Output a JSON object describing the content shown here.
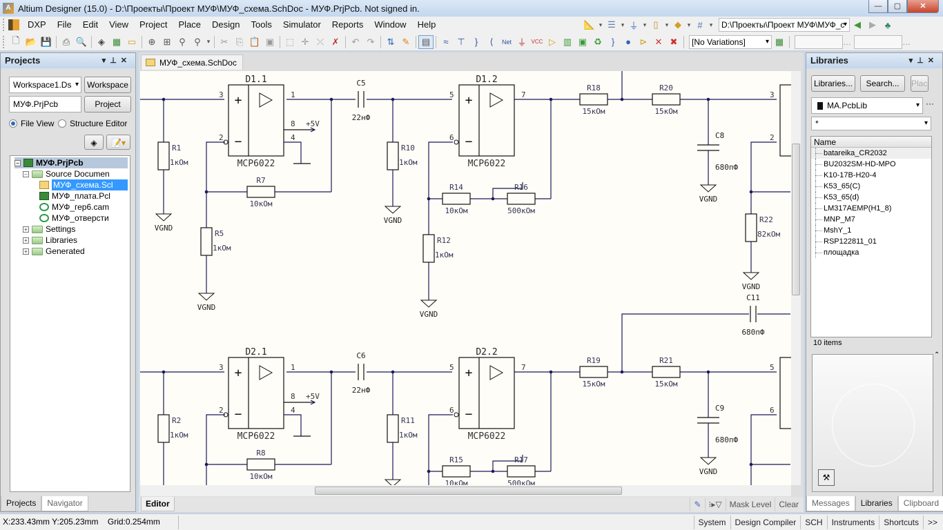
{
  "window": {
    "title": "Altium Designer (15.0) - D:\\Проекты\\Проект МУФ\\МУФ_схема.SchDoc - МУФ.PrjPcb. Not signed in.",
    "app_icon": "altium-logo-icon",
    "controls": {
      "minimize": "—",
      "maximize": "▢",
      "close": "✕"
    }
  },
  "menubar": {
    "items": [
      "DXP",
      "File",
      "Edit",
      "View",
      "Project",
      "Place",
      "Design",
      "Tools",
      "Simulator",
      "Reports",
      "Window",
      "Help"
    ],
    "path_combo": "D:\\Проекты\\Проект МУФ\\МУФ_с",
    "right_tools": [
      "measure-icon",
      "align-icon",
      "power-port-icon",
      "part-icon",
      "port-icon",
      "grid-icon"
    ]
  },
  "toolbar": {
    "buttons": [
      "new-icon",
      "open-icon",
      "save-icon",
      "print-icon",
      "print-preview-icon",
      "compile-icon",
      "pcb-icon",
      "sch-icon",
      "zoom-fit-icon",
      "zoom-area-icon",
      "zoom-selected-icon",
      "zoom-filter-icon",
      "cut-icon",
      "copy-icon",
      "paste-icon",
      "rubber-stamp-icon",
      "select-icon",
      "move-icon",
      "deselect-icon",
      "clear-filter-icon",
      "undo-icon",
      "redo-icon",
      "cross-probe-icon",
      "wand-icon",
      "browse-icon",
      "wire-icon",
      "bus-icon",
      "bus-entry-icon",
      "harness-icon",
      "net-label-icon",
      "ground-icon",
      "vcc-icon",
      "port-icon",
      "sheet-symbol-icon",
      "sheet-entry-icon",
      "device-sheet-icon",
      "harness-connector-icon",
      "harness-entry-icon",
      "parameter-icon",
      "no-erc-icon",
      "compile-mask-icon"
    ],
    "variations": "[No Variations]"
  },
  "projects_panel": {
    "title": "Projects",
    "workspace_combo": "Workspace1.Ds",
    "workspace_button": "Workspace",
    "project_field": "МУФ.PrjPcb",
    "project_button": "Project",
    "radio_file_view": "File View",
    "radio_structure": "Structure Editor",
    "selected_view": "File View",
    "tree": {
      "root": "МУФ.PrjPcb",
      "source_folder": "Source Documen",
      "docs": [
        {
          "name": "МУФ_схема.Scl",
          "type": "sch",
          "selected": true
        },
        {
          "name": "МУФ_плата.Pcl",
          "type": "pcb"
        },
        {
          "name": "МУФ_гер6.cam",
          "type": "cam"
        },
        {
          "name": "МУФ_отверсти",
          "type": "cam"
        }
      ],
      "folders": [
        "Settings",
        "Libraries",
        "Generated"
      ]
    },
    "tabs": [
      "Projects",
      "Navigator"
    ]
  },
  "editor": {
    "doc_tab": "МУФ_схема.SchDoc",
    "bottom_tab": "Editor",
    "mask_level": "Mask Level",
    "clear": "Clear"
  },
  "schematic": {
    "opamps": [
      {
        "ref": "D1.1",
        "part": "MCP6022",
        "pins": [
          "3",
          "2",
          "1",
          "8",
          "4"
        ],
        "supply": "+5V"
      },
      {
        "ref": "D1.2",
        "part": "MCP6022",
        "pins": [
          "5",
          "6",
          "7"
        ]
      },
      {
        "ref": "D2.1",
        "part": "MCP6022",
        "pins": [
          "3",
          "2",
          "1",
          "8",
          "4"
        ],
        "supply": "+5V"
      },
      {
        "ref": "D2.2",
        "part": "MCP6022",
        "pins": [
          "5",
          "6",
          "7"
        ]
      }
    ],
    "resistors": [
      {
        "ref": "R1",
        "value": "1кОм"
      },
      {
        "ref": "R5",
        "value": "1кОм"
      },
      {
        "ref": "R7",
        "value": "10кОм"
      },
      {
        "ref": "R10",
        "value": "1кОм"
      },
      {
        "ref": "R14",
        "value": "10кОм"
      },
      {
        "ref": "R16",
        "value": "500кОм"
      },
      {
        "ref": "R12",
        "value": "1кОм"
      },
      {
        "ref": "R18",
        "value": "15кОм"
      },
      {
        "ref": "R20",
        "value": "15кОм"
      },
      {
        "ref": "R22",
        "value": "82кОм"
      },
      {
        "ref": "R2",
        "value": "1кОм"
      },
      {
        "ref": "R8",
        "value": "10кОм"
      },
      {
        "ref": "R11",
        "value": "1кОм"
      },
      {
        "ref": "R15",
        "value": "10кОм"
      },
      {
        "ref": "R17",
        "value": "500кОм"
      },
      {
        "ref": "R19",
        "value": "15кОм"
      },
      {
        "ref": "R21",
        "value": "15кОм"
      }
    ],
    "capacitors": [
      {
        "ref": "C5",
        "value": "22нФ"
      },
      {
        "ref": "C8",
        "value": "680пФ"
      },
      {
        "ref": "C11",
        "value": "680пФ"
      },
      {
        "ref": "C6",
        "value": "22нФ"
      },
      {
        "ref": "C9",
        "value": "680пФ"
      }
    ],
    "ground_label": "VGND",
    "right_pins": [
      "3",
      "2",
      "5",
      "6"
    ]
  },
  "libraries_panel": {
    "title": "Libraries",
    "btn_libraries": "Libraries...",
    "btn_search": "Search...",
    "btn_place": "Place",
    "library_combo": "MA.PcbLib",
    "filter": "*",
    "column": "Name",
    "items": [
      "batareika_CR2032",
      "BU2032SM-HD-MPO",
      "K10-17B-H20-4",
      "K53_65(C)",
      "K53_65(d)",
      "LM317AEMP(H1_8)",
      "MNP_M7",
      "MshY_1",
      "RSP122811_01",
      "площадка"
    ],
    "count": "10 items",
    "tabs": [
      "Messages",
      "Libraries",
      "Clipboard"
    ],
    "active_tab": "Libraries"
  },
  "statusbar": {
    "coords": "X:233.43mm Y:205.23mm",
    "grid": "Grid:0.254mm",
    "tabs": [
      "System",
      "Design Compiler",
      "SCH",
      "Instruments",
      "Shortcuts",
      ">>"
    ]
  }
}
